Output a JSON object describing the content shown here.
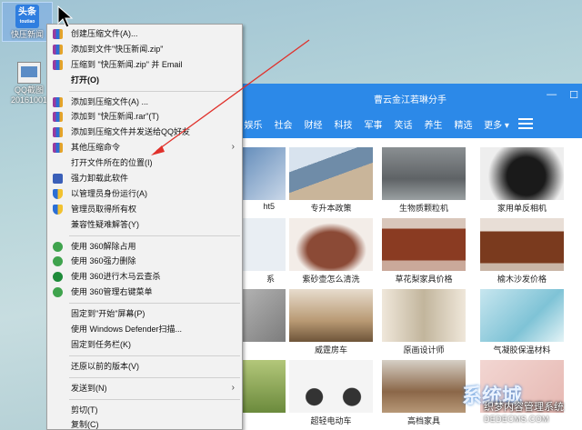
{
  "desktop": {
    "icons": [
      {
        "label": "快压新闻",
        "logo_text": "头条",
        "logo_sub": "toutiao"
      },
      {
        "label": "QQ截图",
        "sub": "20161001"
      }
    ]
  },
  "context_menu": {
    "items": [
      "创建压缩文件(A)...",
      "添加到文件\"快压新闻.zip\"",
      "压缩到 \"快压新闻.zip\" 并 Email",
      "打开(O)",
      "添加到压缩文件(A) ...",
      "添加到 \"快压新闻.rar\"(T)",
      "添加到压缩文件并发送给QQ好友",
      "其他压缩命令",
      "打开文件所在的位置(I)",
      "强力卸载此软件",
      "以管理员身份运行(A)",
      "管理员取得所有权",
      "兼容性疑难解答(Y)",
      "使用 360解除占用",
      "使用 360强力删除",
      "使用 360进行木马云查杀",
      "使用 360管理右键菜单",
      "固定到\"开始\"屏幕(P)",
      "使用 Windows Defender扫描...",
      "固定到任务栏(K)",
      "还原以前的版本(V)",
      "发送到(N)",
      "剪切(T)",
      "复制(C)"
    ]
  },
  "browser": {
    "title": "曹云金江若琳分手",
    "nav": [
      "娱乐",
      "社会",
      "财经",
      "科技",
      "军事",
      "笑话",
      "养生",
      "精选",
      "更多"
    ],
    "cards": [
      {
        "caption": "ht5"
      },
      {
        "caption": "专升本政策"
      },
      {
        "caption": "生物质颗粒机"
      },
      {
        "caption": "家用单反相机"
      },
      {
        "caption": "系"
      },
      {
        "caption": "紫砂壶怎么清洗"
      },
      {
        "caption": "草花梨家具价格"
      },
      {
        "caption": "榆木沙发价格"
      },
      {
        "caption": ""
      },
      {
        "caption": "威霆房车"
      },
      {
        "caption": "原画设计师"
      },
      {
        "caption": "气凝胶保温材料"
      },
      {
        "caption": ""
      },
      {
        "caption": "超轻电动车"
      },
      {
        "caption": "高档家具"
      },
      {
        "caption": ""
      }
    ]
  },
  "watermark": {
    "logo": "系统城",
    "title": "织梦内容管理系统",
    "url": "DEDECMS.COM"
  },
  "colors": {
    "accent": "#2c89e8",
    "menu_bg": "#f2f2f2",
    "arrow": "#e0302a"
  }
}
